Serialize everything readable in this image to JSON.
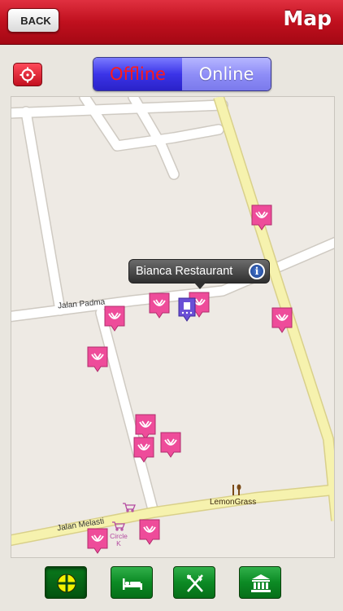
{
  "header": {
    "back_label": "BACK",
    "title": "Map"
  },
  "toggle": {
    "offline_label": "Offline",
    "online_label": "Online",
    "selected": "Offline"
  },
  "map": {
    "callout": {
      "title": "Bianca Restaurant",
      "info_icon": "info-icon"
    },
    "road_labels": {
      "padma": "Jalan Padma",
      "melasti": "Jalan Melasti"
    },
    "poi_labels": {
      "lemongrass": "LemonGrass",
      "circle_k": "Circle K"
    }
  },
  "bottom_bar": {
    "tabs": [
      {
        "name": "all-places",
        "icon": "crosshair-icon",
        "active": true
      },
      {
        "name": "hotels",
        "icon": "bed-icon",
        "active": false
      },
      {
        "name": "restaurants",
        "icon": "fork-knife-icon",
        "active": false
      },
      {
        "name": "attractions",
        "icon": "museum-icon",
        "active": false
      }
    ]
  },
  "colors": {
    "header_red": "#c0101e",
    "toggle_blue": "#3b34e8",
    "pin_pink": "#ee4c9a",
    "road_yellow": "#f5f0a8",
    "button_green": "#0c8a24"
  }
}
